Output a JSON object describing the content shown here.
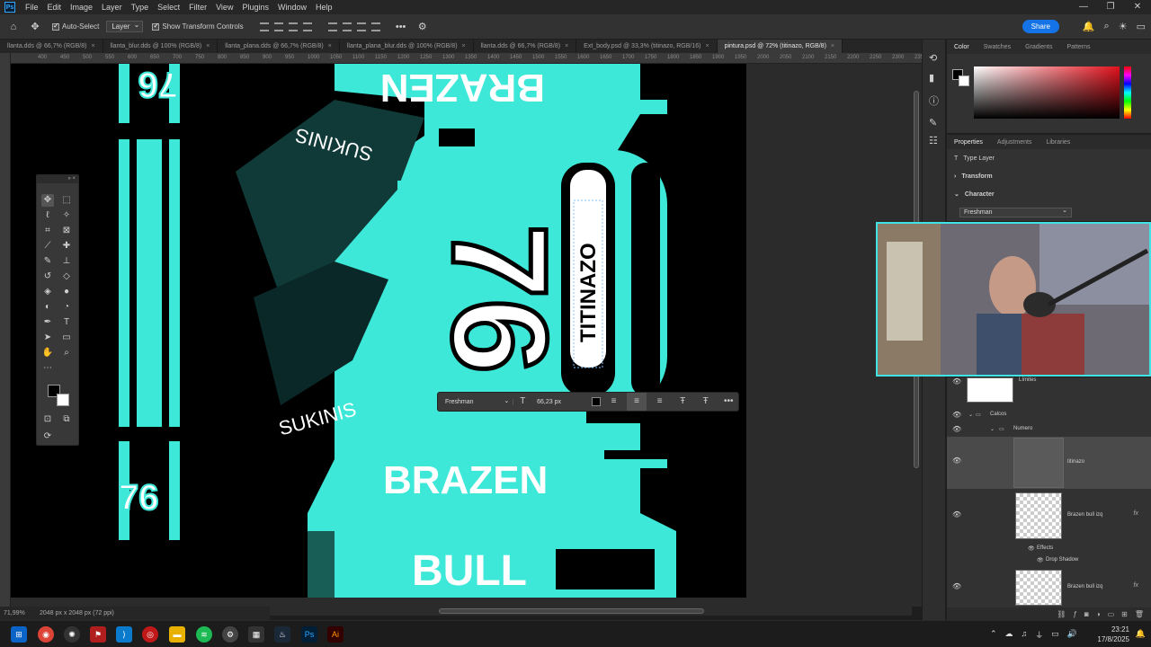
{
  "app": {
    "logo": "Ps"
  },
  "menu": [
    "File",
    "Edit",
    "Image",
    "Layer",
    "Type",
    "Select",
    "Filter",
    "View",
    "Plugins",
    "Window",
    "Help"
  ],
  "window_controls": [
    "—",
    "❐",
    "✕"
  ],
  "options": {
    "auto_select_label": "Auto-Select",
    "auto_select_target": "Layer",
    "show_transform_label": "Show Transform Controls",
    "more": "•••",
    "share_label": "Share"
  },
  "tabs": [
    {
      "label": "llanta.dds @ 66,7% (RGB/8)"
    },
    {
      "label": "llanta_blur.dds @ 100% (RGB/8)"
    },
    {
      "label": "llanta_plana.dds @ 66,7% (RGB/8)"
    },
    {
      "label": "llanta_plana_blur.dds @ 100% (RGB/8)"
    },
    {
      "label": "llanta.dds @ 66,7% (RGB/8)"
    },
    {
      "label": "Ext_body.psd @ 33,3% (titinazo, RGB/16)"
    },
    {
      "label": "pintura.psd @ 72% (titinazo, RGB/8)"
    }
  ],
  "ruler_ticks": [
    "400",
    "450",
    "500",
    "550",
    "600",
    "650",
    "700",
    "750",
    "800",
    "850",
    "900",
    "950",
    "1000",
    "1050",
    "1100",
    "1150",
    "1200",
    "1250",
    "1300",
    "1350",
    "1400",
    "1450",
    "1500",
    "1550",
    "1600",
    "1650",
    "1700",
    "1750",
    "1800",
    "1850",
    "1900",
    "1950",
    "2000",
    "2050",
    "2100",
    "2150",
    "2200",
    "2250",
    "2300",
    "2350",
    "2400"
  ],
  "canvas": {
    "top_number": "76",
    "bottom_number": "76",
    "brazen_top": "BRAZEN",
    "brazen_bottom": "BRAZEN",
    "bull": "BULL",
    "sukinis": "SUKINIS",
    "big_number": "76",
    "vertical_name": "TITINAZO",
    "accent_color": "#3ee8d8"
  },
  "context_bar": {
    "font": "Freshman",
    "size": "66,23 px",
    "more": "•••"
  },
  "status": {
    "zoom": "71,99%",
    "doc_size": "2048 px x 2048 px (72 ppi)"
  },
  "color_panel": {
    "tabs": [
      "Color",
      "Swatches",
      "Gradients",
      "Patterns"
    ]
  },
  "properties": {
    "tabs": [
      "Properties",
      "Adjustments",
      "Libraries"
    ],
    "layer_type": "Type Layer",
    "transform": "Transform",
    "character": "Character",
    "font": "Freshman"
  },
  "layers": {
    "rows": [
      {
        "name": "Límites"
      },
      {
        "name": "Calcos"
      },
      {
        "name": "Numero"
      },
      {
        "name": "titinazo"
      },
      {
        "name": "Brazen bull izq"
      },
      {
        "name": "Effects"
      },
      {
        "name": "Drop Shadow"
      },
      {
        "name": "Brazen bull izq"
      }
    ],
    "fx": "fx"
  },
  "clock": {
    "time": "23:21",
    "date": "17/8/2025"
  }
}
